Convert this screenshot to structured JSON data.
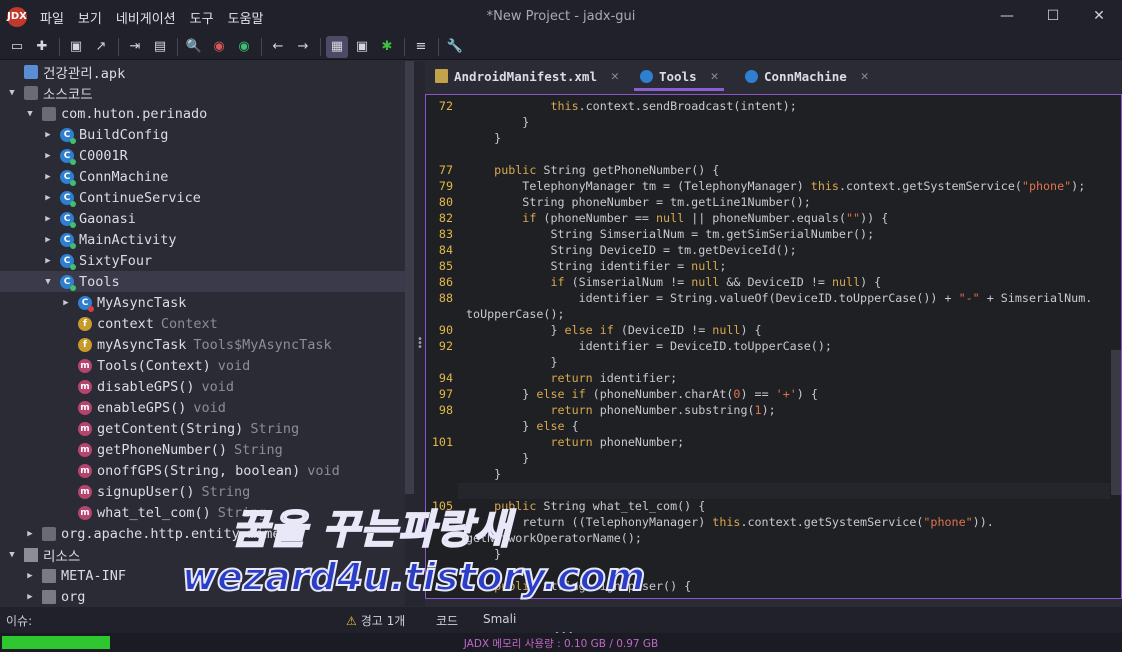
{
  "window": {
    "title": "*New Project - jadx-gui",
    "logo_text": "JDX",
    "controls": {
      "minimize": "—",
      "maximize": "☐",
      "close": "✕"
    }
  },
  "menu": [
    "파일",
    "보기",
    "네비게이션",
    "도구",
    "도움말"
  ],
  "toolbar": {
    "icons": [
      "open-folder-icon",
      "add-file-icon",
      "save-icon",
      "export-icon",
      "sync-icon",
      "flatten-packages-icon",
      "search-icon",
      "find-class-icon",
      "find-usage-icon",
      "back-icon",
      "forward-icon",
      "deobfuscation-icon",
      "quark-icon",
      "debug-icon",
      "log-icon",
      "preferences-icon"
    ],
    "glyphs": [
      "▭",
      "✚",
      "▣",
      "↗",
      "⇥",
      "▤",
      "🔍",
      "◉",
      "◉",
      "←",
      "→",
      "▦",
      "▣",
      "✱",
      "≡",
      "🔧"
    ]
  },
  "tree": {
    "rows": [
      {
        "indent": 0,
        "arrow": "",
        "icon": "apk",
        "label": "건강관리.apk",
        "type": ""
      },
      {
        "indent": 0,
        "arrow": "▼",
        "icon": "pkg",
        "label": "소스코드",
        "type": ""
      },
      {
        "indent": 1,
        "arrow": "▼",
        "icon": "pkg",
        "label": "com.huton.perinado",
        "type": ""
      },
      {
        "indent": 2,
        "arrow": "▶",
        "icon": "cls",
        "label": "BuildConfig",
        "type": ""
      },
      {
        "indent": 2,
        "arrow": "▶",
        "icon": "cls",
        "label": "C0001R",
        "type": ""
      },
      {
        "indent": 2,
        "arrow": "▶",
        "icon": "cls",
        "label": "ConnMachine",
        "type": ""
      },
      {
        "indent": 2,
        "arrow": "▶",
        "icon": "cls",
        "label": "ContinueService",
        "type": ""
      },
      {
        "indent": 2,
        "arrow": "▶",
        "icon": "cls",
        "label": "Gaonasi",
        "type": ""
      },
      {
        "indent": 2,
        "arrow": "▶",
        "icon": "cls",
        "label": "MainActivity",
        "type": ""
      },
      {
        "indent": 2,
        "arrow": "▶",
        "icon": "cls",
        "label": "SixtyFour",
        "type": ""
      },
      {
        "indent": 2,
        "arrow": "▼",
        "icon": "cls",
        "label": "Tools",
        "type": "",
        "selected": true
      },
      {
        "indent": 3,
        "arrow": "▶",
        "icon": "cls-red",
        "label": "MyAsyncTask",
        "type": ""
      },
      {
        "indent": 3,
        "arrow": "",
        "icon": "fld",
        "label": "context",
        "type": "Context"
      },
      {
        "indent": 3,
        "arrow": "",
        "icon": "fld",
        "label": "myAsyncTask",
        "type": "Tools$MyAsyncTask"
      },
      {
        "indent": 3,
        "arrow": "",
        "icon": "mth",
        "label": "Tools(Context)",
        "type": "void"
      },
      {
        "indent": 3,
        "arrow": "",
        "icon": "mth",
        "label": "disableGPS()",
        "type": "void"
      },
      {
        "indent": 3,
        "arrow": "",
        "icon": "mth",
        "label": "enableGPS()",
        "type": "void"
      },
      {
        "indent": 3,
        "arrow": "",
        "icon": "mth",
        "label": "getContent(String)",
        "type": "String"
      },
      {
        "indent": 3,
        "arrow": "",
        "icon": "mth",
        "label": "getPhoneNumber()",
        "type": "String"
      },
      {
        "indent": 3,
        "arrow": "",
        "icon": "mth",
        "label": "onoffGPS(String, boolean)",
        "type": "void"
      },
      {
        "indent": 3,
        "arrow": "",
        "icon": "mth",
        "label": "signupUser()",
        "type": "String"
      },
      {
        "indent": 3,
        "arrow": "",
        "icon": "mth",
        "label": "what_tel_com()",
        "type": "String"
      },
      {
        "indent": 1,
        "arrow": "▶",
        "icon": "pkg",
        "label": "org.apache.http.entity.mime",
        "type": ""
      },
      {
        "indent": 0,
        "arrow": "▼",
        "icon": "res",
        "label": "리소스",
        "type": ""
      },
      {
        "indent": 1,
        "arrow": "▶",
        "icon": "folder",
        "label": "META-INF",
        "type": ""
      },
      {
        "indent": 1,
        "arrow": "▶",
        "icon": "folder",
        "label": "org",
        "type": ""
      }
    ]
  },
  "tabs": [
    {
      "label": "AndroidManifest.xml",
      "icon": "manifest-icon",
      "close": "✕",
      "active": false
    },
    {
      "label": "Tools",
      "icon": "class-icon",
      "close": "✕",
      "active": true
    },
    {
      "label": "ConnMachine",
      "icon": "class-icon",
      "close": "✕",
      "active": false
    }
  ],
  "code": [
    {
      "ln": "72",
      "html": "            <span class='kw'>this</span>.context.sendBroadcast(intent);"
    },
    {
      "ln": "",
      "html": "        }"
    },
    {
      "ln": "",
      "html": "    }"
    },
    {
      "ln": "",
      "html": ""
    },
    {
      "ln": "77",
      "html": "    <span class='kw'>public</span> String getPhoneNumber() {"
    },
    {
      "ln": "79",
      "html": "        TelephonyManager tm = (TelephonyManager) <span class='kw'>this</span>.context.getSystemService(<span class='str'>\"phone\"</span>);"
    },
    {
      "ln": "80",
      "html": "        String phoneNumber = tm.getLine1Number();"
    },
    {
      "ln": "82",
      "html": "        <span class='kw'>if</span> (phoneNumber == <span class='kw'>null</span> || phoneNumber.equals(<span class='str'>\"\"</span>)) {"
    },
    {
      "ln": "83",
      "html": "            String SimserialNum = tm.getSimSerialNumber();"
    },
    {
      "ln": "84",
      "html": "            String DeviceID = tm.getDeviceId();"
    },
    {
      "ln": "85",
      "html": "            String identifier = <span class='kw'>null</span>;"
    },
    {
      "ln": "86",
      "html": "            <span class='kw'>if</span> (SimserialNum != <span class='kw'>null</span> &amp;&amp; DeviceID != <span class='kw'>null</span>) {"
    },
    {
      "ln": "88",
      "html": "                identifier = String.valueOf(DeviceID.toUpperCase()) + <span class='str'>\"-\"</span> + SimserialNum."
    },
    {
      "ln": "",
      "html": "toUpperCase();"
    },
    {
      "ln": "90",
      "html": "            } <span class='kw'>else if</span> (DeviceID != <span class='kw'>null</span>) {"
    },
    {
      "ln": "92",
      "html": "                identifier = DeviceID.toUpperCase();"
    },
    {
      "ln": "",
      "html": "            }"
    },
    {
      "ln": "94",
      "html": "            <span class='kw'>return</span> identifier;"
    },
    {
      "ln": "97",
      "html": "        } <span class='kw'>else if</span> (phoneNumber.charAt(<span class='str'>0</span>) == <span class='str'>'+'</span>) {"
    },
    {
      "ln": "98",
      "html": "            <span class='kw'>return</span> phoneNumber.substring(<span class='str'>1</span>);"
    },
    {
      "ln": "",
      "html": "        } <span class='kw'>else</span> {"
    },
    {
      "ln": "101",
      "html": "            <span class='kw'>return</span> phoneNumber;"
    },
    {
      "ln": "",
      "html": "        }"
    },
    {
      "ln": "",
      "html": "    }"
    },
    {
      "ln": "",
      "html": ""
    },
    {
      "ln": "105",
      "html": "    <span class='kw'>public</span> String what_tel_com() {"
    },
    {
      "ln": "",
      "html": "        return ((TelephonyManager) <span class='kw'>this</span>.context.getSystemService(<span class='str'>\"phone\"</span>))."
    },
    {
      "ln": "",
      "html": "getNetworkOperatorName();"
    },
    {
      "ln": "",
      "html": "    }"
    },
    {
      "ln": "",
      "html": ""
    },
    {
      "ln": "",
      "html": "    <span class='kw'>public</span> String signupUser() {"
    }
  ],
  "status": {
    "issues_label": "이슈:",
    "warning_label": "경고 1개",
    "code_tab": "코드",
    "smali_tab": "Smali",
    "grip": "•••"
  },
  "memory": {
    "label": "JADX 메모리 사용량 : 0.10 GB / 0.97 GB",
    "used_fraction": 0.1
  },
  "watermark": {
    "line1": "꿈을 꾸는파랑새",
    "line2": "wezard4u.tistory.com"
  }
}
